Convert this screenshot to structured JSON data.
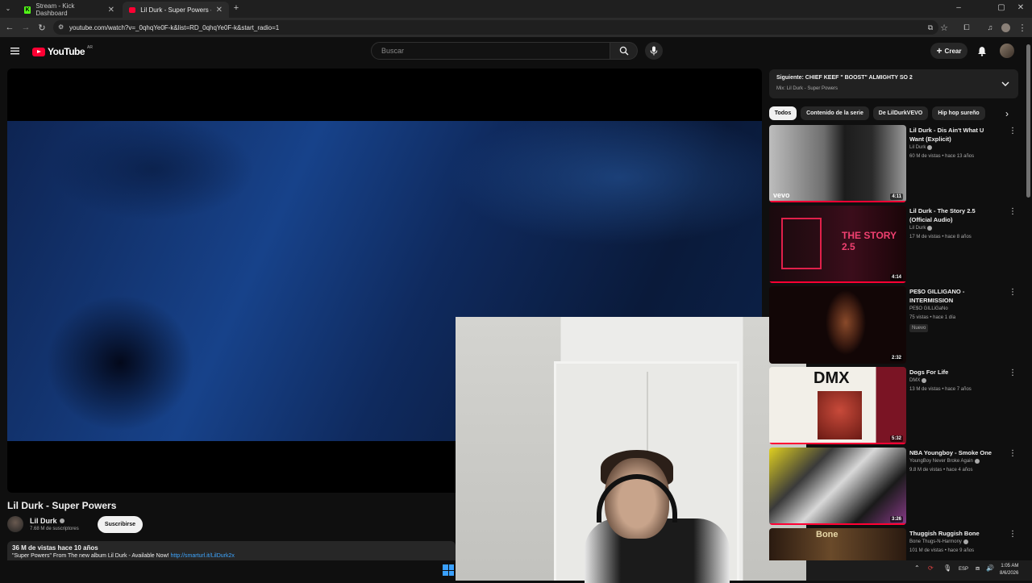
{
  "browser": {
    "tabs": [
      {
        "label": "Stream - Kick Dashboard",
        "active": false
      },
      {
        "label": "Lil Durk - Super Powers - YouTu",
        "active": true
      }
    ],
    "url": "youtube.com/watch?v=_0qhqYe0F-k&list=RD_0qhqYe0F-k&start_radio=1"
  },
  "header": {
    "logo_text": "YouTube",
    "country_code": "AR",
    "search_placeholder": "Buscar",
    "create_label": "Crear"
  },
  "video": {
    "title": "Lil Durk - Super Powers",
    "channel": "Lil Durk",
    "subscribers": "7.68 M de suscriptores",
    "subscribe_label": "Suscribirse",
    "views_date": "36 M de vistas  hace 10 años",
    "description": "\"Super Powers\" From The new album Lil Durk - Available Now! ",
    "description_link": "http://smarturl.it/LilDurk2x"
  },
  "playlist": {
    "next": "Siguiente: CHIEF KEEF \" BOOST\" ALMIGHTY SO 2",
    "mix": "Mix: Lil Durk - Super Powers"
  },
  "chips": [
    "Todos",
    "Contenido de la serie",
    "De LilDurkVEVO",
    "Hip hop sureño"
  ],
  "recommendations": [
    {
      "title": "Lil Durk - Dis Ain't What U Want (Explicit)",
      "channel": "Lil Durk",
      "verified": true,
      "meta": "60 M de vistas • hace 13 años",
      "duration": "4:11",
      "watched": 1.0
    },
    {
      "title": "Lil Durk - The Story 2.5 (Official Audio)",
      "channel": "Lil Durk",
      "verified": true,
      "meta": "17 M de vistas • hace 8 años",
      "duration": "4:14",
      "watched": 1.0
    },
    {
      "title": "PE$O GILLIGANO  - INTERMISSION",
      "channel": "PE$O GILLiGaNo",
      "verified": false,
      "meta": "75 vistas • hace 1 día",
      "badge": "Nuevo",
      "duration": "2:32",
      "watched": 0.0
    },
    {
      "title": "Dogs For Life",
      "channel": "DMX",
      "verified": true,
      "meta": "13 M de vistas • hace 7 años",
      "duration": "5:32",
      "watched": 1.0
    },
    {
      "title": "NBA Youngboy - Smoke One",
      "channel": "YoungBoy Never Broke Again",
      "verified": true,
      "meta": "9.8 M de vistas • hace 4 años",
      "duration": "3:26",
      "watched": 1.0
    },
    {
      "title": "Thuggish Ruggish Bone",
      "channel": "Bone Thugs-N-Harmony",
      "verified": true,
      "meta": "101 M de vistas • hace 9 años",
      "duration": "",
      "watched": 0.0
    }
  ],
  "taskbar": {
    "language": "ESP",
    "time": "1:05 AM",
    "date": "8/6/2026"
  },
  "colors": {
    "background": "#0f0f0f",
    "brand_red": "#ff0033",
    "link": "#3ea6ff",
    "chip_bg": "#272727"
  }
}
